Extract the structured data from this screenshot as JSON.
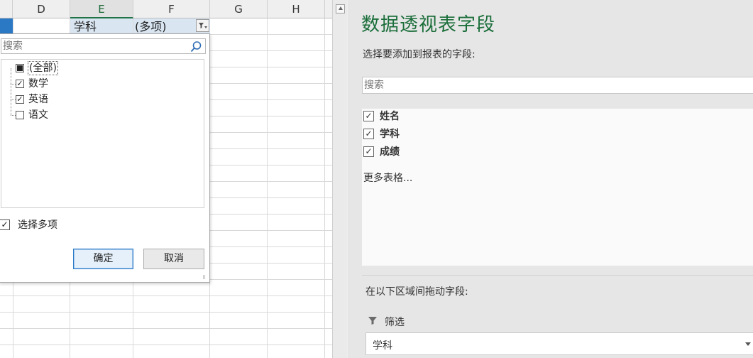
{
  "sheet": {
    "columns": [
      "D",
      "E",
      "F",
      "G",
      "H"
    ],
    "selected_column": "E",
    "cells": {
      "e1": "学科",
      "f1": "(多项)"
    }
  },
  "filter_popup": {
    "search_placeholder": "搜索",
    "items": [
      {
        "label": "(全部)",
        "state": "partial"
      },
      {
        "label": "数学",
        "state": "checked"
      },
      {
        "label": "英语",
        "state": "checked"
      },
      {
        "label": "语文",
        "state": "unchecked"
      }
    ],
    "multi_select_label": "选择多项",
    "multi_select_checked": true,
    "ok_label": "确定",
    "cancel_label": "取消"
  },
  "pivot_pane": {
    "title": "数据透视表字段",
    "subtitle": "选择要添加到报表的字段:",
    "search_placeholder": "搜索",
    "fields": [
      {
        "label": "姓名",
        "checked": true
      },
      {
        "label": "学科",
        "checked": true
      },
      {
        "label": "成绩",
        "checked": true
      }
    ],
    "more_tables": "更多表格...",
    "drag_hint": "在以下区域间拖动字段:",
    "filter_area_label": "筛选",
    "filter_chip_label": "学科"
  },
  "colors": {
    "title_green": "#1b6e3a",
    "selection_blue": "#2b78c5",
    "cell_highlight": "#d9e6f2",
    "pane_bg": "#e6e6e6"
  },
  "icons": [
    "search-icon",
    "filter-dropdown-icon",
    "funnel-icon",
    "chevron-down-icon",
    "scroll-up-icon",
    "resize-grip-icon"
  ]
}
